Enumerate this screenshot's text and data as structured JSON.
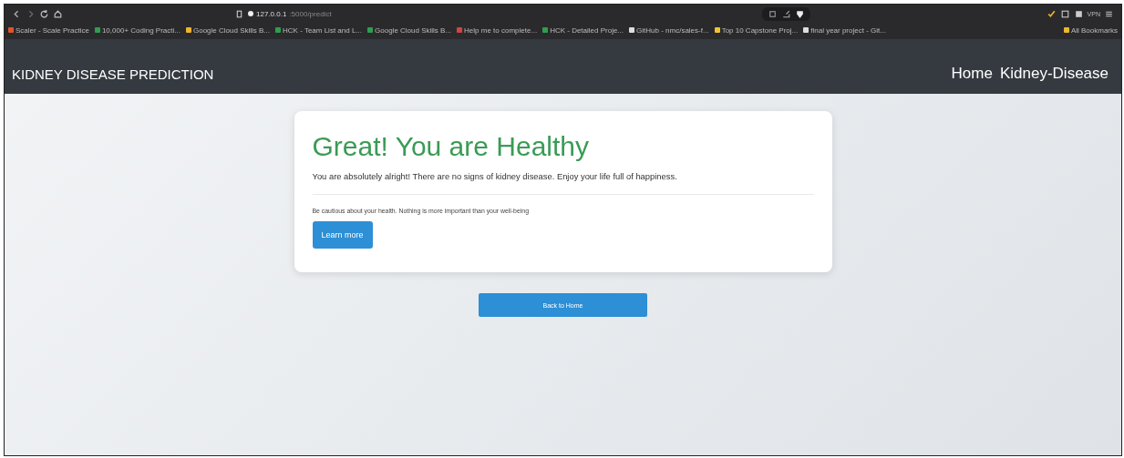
{
  "browser": {
    "url_host": "127.0.0.1",
    "url_path": ":5000/predict",
    "vpn_label": "VPN",
    "bookmarks": [
      {
        "label": "Scaler - Scale Practice",
        "color": "#e0552b"
      },
      {
        "label": "10,000+ Coding Practi...",
        "color": "#2e9e4f"
      },
      {
        "label": "Google Cloud Skills B...",
        "color": "#f2b230"
      },
      {
        "label": "HCK - Team List and L...",
        "color": "#2e9e4f"
      },
      {
        "label": "Google Cloud Skills B...",
        "color": "#2e9e4f"
      },
      {
        "label": "Help me to complete...",
        "color": "#d0463c"
      },
      {
        "label": "HCK - Detailed Proje...",
        "color": "#2e9e4f"
      },
      {
        "label": "GitHub - nmc/sales-f...",
        "color": "#dddddd"
      },
      {
        "label": "Top 10 Capstone Proj...",
        "color": "#f2c230"
      },
      {
        "label": "final year project - Git...",
        "color": "#dddddd"
      }
    ],
    "all_bookmarks": "All Bookmarks"
  },
  "navbar": {
    "brand": "KIDNEY DISEASE PREDICTION",
    "links": [
      "Home",
      "Kidney-Disease"
    ]
  },
  "result": {
    "heading": "Great! You are Healthy",
    "lead": "You are absolutely alright! There are no signs of kidney disease. Enjoy your life full of happiness.",
    "note": "Be cautious about your health. Nothing is more important than your well-being",
    "button": "Learn more"
  },
  "back_button": "Back to Home"
}
